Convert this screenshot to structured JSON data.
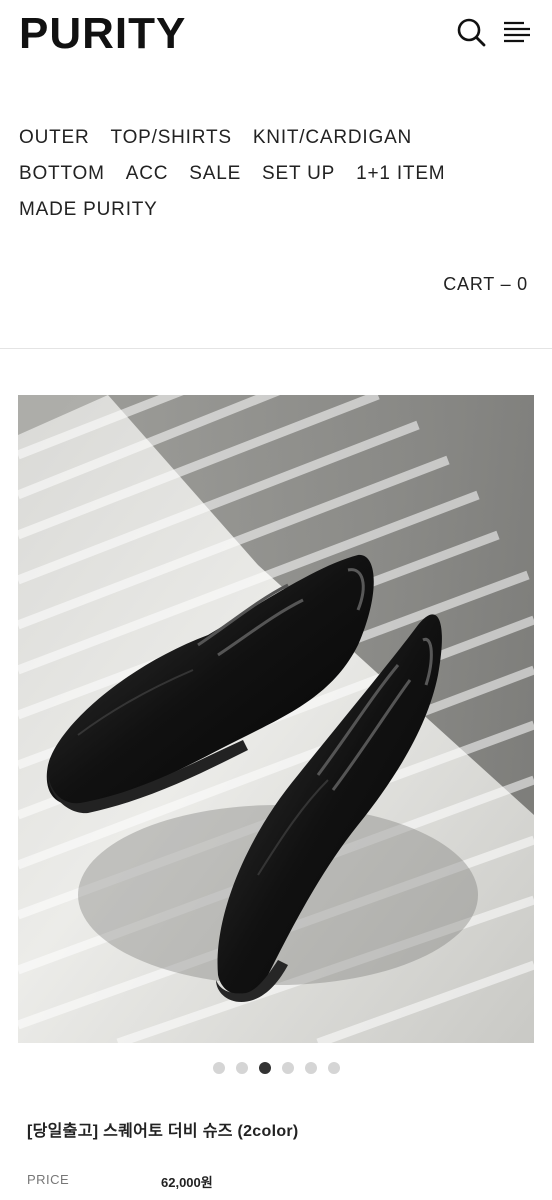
{
  "brand": {
    "logo": "PURITY"
  },
  "header": {
    "search_icon": "search-icon",
    "menu_icon": "menu-icon"
  },
  "nav": {
    "rows": [
      [
        "OUTER",
        "TOP/SHIRTS",
        "KNIT/CARDIGAN"
      ],
      [
        "BOTTOM",
        "ACC",
        "SALE",
        "SET UP",
        "1+1 ITEM"
      ],
      [
        "MADE PURITY"
      ]
    ]
  },
  "cart": {
    "label": "CART – 0"
  },
  "gallery": {
    "image_icon": "black-square-toe-derby-shoes-photo",
    "dot_count": 6,
    "active_index": 2
  },
  "product": {
    "title": "[당일출고] 스퀘어토 더비 슈즈 (2color)",
    "price_label": "PRICE",
    "price_value": "62,000원"
  },
  "colors": {
    "text": "#111111",
    "divider": "#e4e4e4",
    "dot": "#d5d5d5",
    "dot_active": "#333333"
  }
}
